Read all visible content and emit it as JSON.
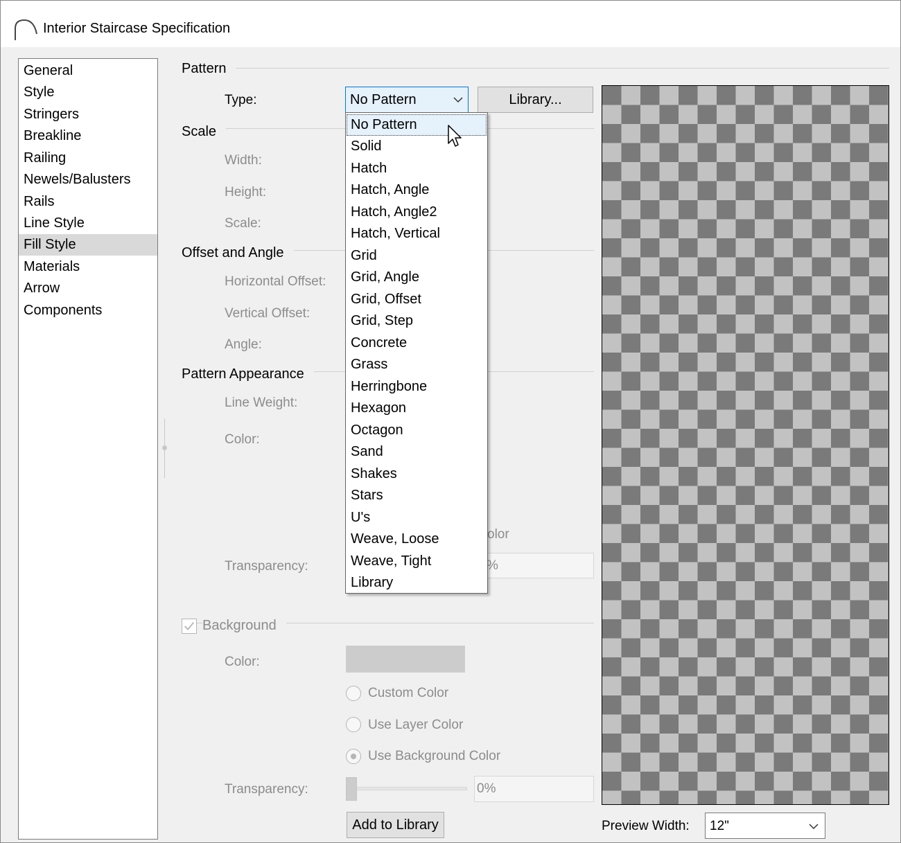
{
  "window": {
    "title": "Interior Staircase Specification"
  },
  "nav": {
    "items": [
      {
        "label": "General"
      },
      {
        "label": "Style"
      },
      {
        "label": "Stringers"
      },
      {
        "label": "Breakline"
      },
      {
        "label": "Railing"
      },
      {
        "label": "Newels/Balusters"
      },
      {
        "label": "Rails"
      },
      {
        "label": "Line Style"
      },
      {
        "label": "Fill Style",
        "selected": true
      },
      {
        "label": "Materials"
      },
      {
        "label": "Arrow"
      },
      {
        "label": "Components"
      }
    ]
  },
  "pattern": {
    "section_label": "Pattern",
    "type_label": "Type:",
    "type_value": "No Pattern",
    "library_button": "Library...",
    "options": [
      "No Pattern",
      "Solid",
      "Hatch",
      "Hatch, Angle",
      "Hatch, Angle2",
      "Hatch, Vertical",
      "Grid",
      "Grid, Angle",
      "Grid, Offset",
      "Grid, Step",
      "Concrete",
      "Grass",
      "Herringbone",
      "Hexagon",
      "Octagon",
      "Sand",
      "Shakes",
      "Stars",
      "U's",
      "Weave, Loose",
      "Weave, Tight",
      "Library"
    ]
  },
  "scale": {
    "section_label": "Scale",
    "width_label": "Width:",
    "height_label": "Height:",
    "scale_label": "Scale:"
  },
  "offset": {
    "section_label": "Offset and Angle",
    "horizontal_label": "Horizontal Offset:",
    "vertical_label": "Vertical Offset:",
    "angle_label": "Angle:"
  },
  "appearance": {
    "section_label": "Pattern Appearance",
    "line_weight_label": "Line Weight:",
    "color_label": "Color:",
    "partial_color_text": "olor",
    "transparency_label": "Transparency:",
    "transparency_value_partial": "%"
  },
  "background": {
    "checkbox_label": "Background",
    "color_label": "Color:",
    "swatch_color": "#cccccc",
    "radio_custom": "Custom Color",
    "radio_layer": "Use Layer Color",
    "radio_background": "Use Background Color",
    "transparency_label": "Transparency:",
    "transparency_value": "0%",
    "add_library_button": "Add to Library"
  },
  "preview": {
    "width_label": "Preview Width:",
    "width_value": "12\""
  }
}
